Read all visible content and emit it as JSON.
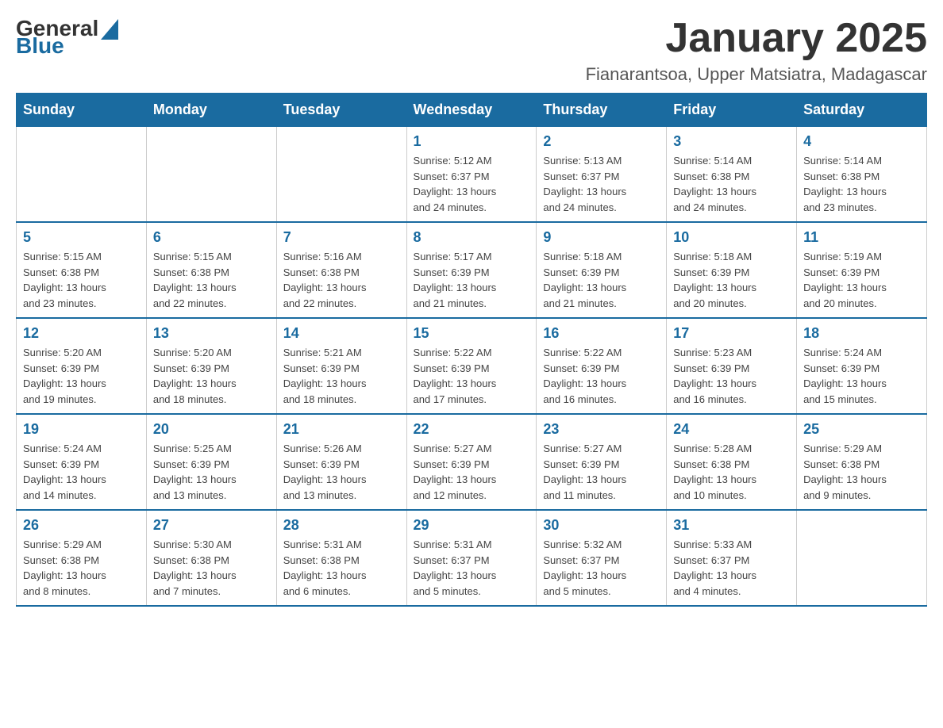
{
  "header": {
    "logo_general": "General",
    "logo_blue": "Blue",
    "month_title": "January 2025",
    "location": "Fianarantsoa, Upper Matsiatra, Madagascar"
  },
  "weekdays": [
    "Sunday",
    "Monday",
    "Tuesday",
    "Wednesday",
    "Thursday",
    "Friday",
    "Saturday"
  ],
  "weeks": [
    [
      {
        "day": "",
        "info": ""
      },
      {
        "day": "",
        "info": ""
      },
      {
        "day": "",
        "info": ""
      },
      {
        "day": "1",
        "info": "Sunrise: 5:12 AM\nSunset: 6:37 PM\nDaylight: 13 hours\nand 24 minutes."
      },
      {
        "day": "2",
        "info": "Sunrise: 5:13 AM\nSunset: 6:37 PM\nDaylight: 13 hours\nand 24 minutes."
      },
      {
        "day": "3",
        "info": "Sunrise: 5:14 AM\nSunset: 6:38 PM\nDaylight: 13 hours\nand 24 minutes."
      },
      {
        "day": "4",
        "info": "Sunrise: 5:14 AM\nSunset: 6:38 PM\nDaylight: 13 hours\nand 23 minutes."
      }
    ],
    [
      {
        "day": "5",
        "info": "Sunrise: 5:15 AM\nSunset: 6:38 PM\nDaylight: 13 hours\nand 23 minutes."
      },
      {
        "day": "6",
        "info": "Sunrise: 5:15 AM\nSunset: 6:38 PM\nDaylight: 13 hours\nand 22 minutes."
      },
      {
        "day": "7",
        "info": "Sunrise: 5:16 AM\nSunset: 6:38 PM\nDaylight: 13 hours\nand 22 minutes."
      },
      {
        "day": "8",
        "info": "Sunrise: 5:17 AM\nSunset: 6:39 PM\nDaylight: 13 hours\nand 21 minutes."
      },
      {
        "day": "9",
        "info": "Sunrise: 5:18 AM\nSunset: 6:39 PM\nDaylight: 13 hours\nand 21 minutes."
      },
      {
        "day": "10",
        "info": "Sunrise: 5:18 AM\nSunset: 6:39 PM\nDaylight: 13 hours\nand 20 minutes."
      },
      {
        "day": "11",
        "info": "Sunrise: 5:19 AM\nSunset: 6:39 PM\nDaylight: 13 hours\nand 20 minutes."
      }
    ],
    [
      {
        "day": "12",
        "info": "Sunrise: 5:20 AM\nSunset: 6:39 PM\nDaylight: 13 hours\nand 19 minutes."
      },
      {
        "day": "13",
        "info": "Sunrise: 5:20 AM\nSunset: 6:39 PM\nDaylight: 13 hours\nand 18 minutes."
      },
      {
        "day": "14",
        "info": "Sunrise: 5:21 AM\nSunset: 6:39 PM\nDaylight: 13 hours\nand 18 minutes."
      },
      {
        "day": "15",
        "info": "Sunrise: 5:22 AM\nSunset: 6:39 PM\nDaylight: 13 hours\nand 17 minutes."
      },
      {
        "day": "16",
        "info": "Sunrise: 5:22 AM\nSunset: 6:39 PM\nDaylight: 13 hours\nand 16 minutes."
      },
      {
        "day": "17",
        "info": "Sunrise: 5:23 AM\nSunset: 6:39 PM\nDaylight: 13 hours\nand 16 minutes."
      },
      {
        "day": "18",
        "info": "Sunrise: 5:24 AM\nSunset: 6:39 PM\nDaylight: 13 hours\nand 15 minutes."
      }
    ],
    [
      {
        "day": "19",
        "info": "Sunrise: 5:24 AM\nSunset: 6:39 PM\nDaylight: 13 hours\nand 14 minutes."
      },
      {
        "day": "20",
        "info": "Sunrise: 5:25 AM\nSunset: 6:39 PM\nDaylight: 13 hours\nand 13 minutes."
      },
      {
        "day": "21",
        "info": "Sunrise: 5:26 AM\nSunset: 6:39 PM\nDaylight: 13 hours\nand 13 minutes."
      },
      {
        "day": "22",
        "info": "Sunrise: 5:27 AM\nSunset: 6:39 PM\nDaylight: 13 hours\nand 12 minutes."
      },
      {
        "day": "23",
        "info": "Sunrise: 5:27 AM\nSunset: 6:39 PM\nDaylight: 13 hours\nand 11 minutes."
      },
      {
        "day": "24",
        "info": "Sunrise: 5:28 AM\nSunset: 6:38 PM\nDaylight: 13 hours\nand 10 minutes."
      },
      {
        "day": "25",
        "info": "Sunrise: 5:29 AM\nSunset: 6:38 PM\nDaylight: 13 hours\nand 9 minutes."
      }
    ],
    [
      {
        "day": "26",
        "info": "Sunrise: 5:29 AM\nSunset: 6:38 PM\nDaylight: 13 hours\nand 8 minutes."
      },
      {
        "day": "27",
        "info": "Sunrise: 5:30 AM\nSunset: 6:38 PM\nDaylight: 13 hours\nand 7 minutes."
      },
      {
        "day": "28",
        "info": "Sunrise: 5:31 AM\nSunset: 6:38 PM\nDaylight: 13 hours\nand 6 minutes."
      },
      {
        "day": "29",
        "info": "Sunrise: 5:31 AM\nSunset: 6:37 PM\nDaylight: 13 hours\nand 5 minutes."
      },
      {
        "day": "30",
        "info": "Sunrise: 5:32 AM\nSunset: 6:37 PM\nDaylight: 13 hours\nand 5 minutes."
      },
      {
        "day": "31",
        "info": "Sunrise: 5:33 AM\nSunset: 6:37 PM\nDaylight: 13 hours\nand 4 minutes."
      },
      {
        "day": "",
        "info": ""
      }
    ]
  ]
}
